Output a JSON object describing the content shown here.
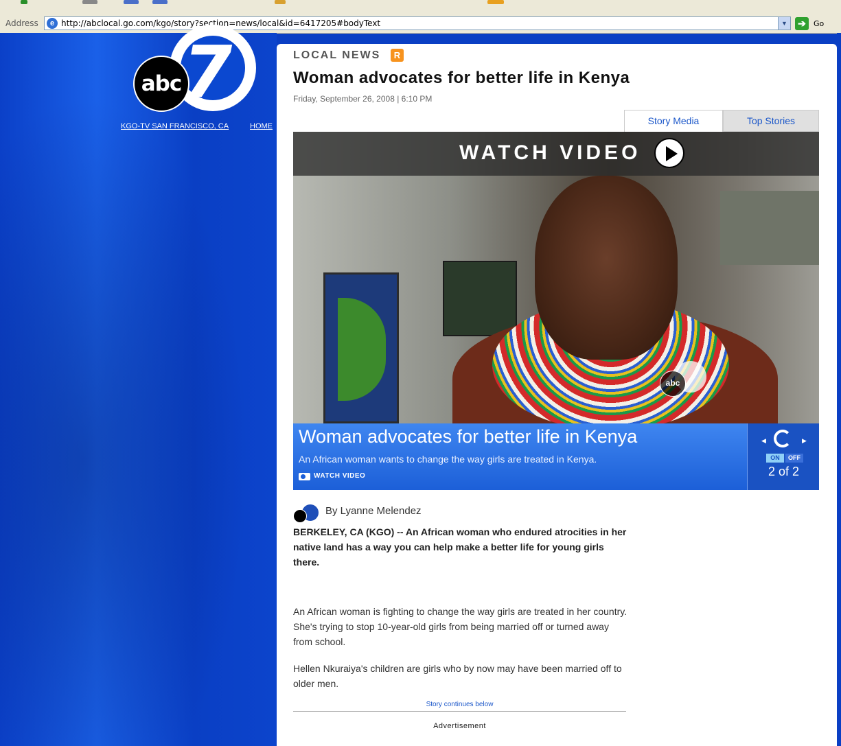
{
  "browser": {
    "address_label": "Address",
    "url": "http://abclocal.go.com/kgo/story?section=news/local&id=6417205#bodyText",
    "go_label": "Go",
    "dropdown_glyph": "▼",
    "go_glyph": "➔"
  },
  "sidebar": {
    "logo_abc": "abc",
    "logo_number": "7",
    "links": [
      "KGO-TV SAN FRANCISCO, CA",
      "HOME"
    ]
  },
  "article": {
    "section": "LOCAL NEWS",
    "rss_glyph": "R",
    "headline": "Woman advocates for better life in Kenya",
    "dateline": "Friday, September 26, 2008 | 6:10 PM",
    "tabs": [
      "Story Media",
      "Top Stories"
    ],
    "media": {
      "watch_title": "WATCH VIDEO",
      "bug_abc": "abc",
      "caption_title": "Woman advocates for better life in Kenya",
      "caption_sub": "An African woman wants to change the way girls are treated in Kenya.",
      "watch_label": "WATCH VIDEO",
      "on": "ON",
      "off": "OFF",
      "count": "2 of 2",
      "prev_glyph": "◀",
      "next_glyph": "▶"
    },
    "byline": "By Lyanne Melendez",
    "lede": "BERKELEY, CA (KGO) -- An African woman who endured atrocities in her native land has a way you can help make a better life for young girls there.",
    "paragraphs": [
      "An African woman is fighting to change the way girls are treated in her country. She's trying to stop 10-year-old girls from being married off or turned away from school.",
      "Hellen Nkuraiya's children are girls who by now may have been married off to older men."
    ],
    "continues": "Story continues below",
    "advertisement": "Advertisement"
  },
  "colors": {
    "sidebar_blue": "#0a3fc4",
    "caption_blue": "#1c5fd8",
    "link_blue": "#1a56c9",
    "rss_orange": "#f7931e"
  }
}
